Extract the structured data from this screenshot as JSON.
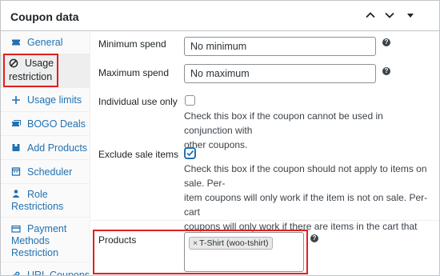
{
  "header": {
    "title": "Coupon data",
    "collapse_up_icon": "chevron-up-icon",
    "collapse_down_icon": "chevron-down-icon",
    "toggle_icon": "triangle-down-icon"
  },
  "sidebar": {
    "items": [
      {
        "label": "General",
        "icon": "ticket-icon"
      },
      {
        "label": "Usage restriction",
        "label_line1": "Usage",
        "label_line2": "restriction",
        "icon": "circle-slash-icon"
      },
      {
        "label": "Usage limits",
        "icon": "plus-sign-icon"
      },
      {
        "label": "BOGO Deals",
        "icon": "tickets-icon"
      },
      {
        "label": "Add Products",
        "icon": "package-icon"
      },
      {
        "label": "Scheduler",
        "icon": "calendar-icon"
      },
      {
        "label": "Role Restrictions",
        "label_line1": "Role",
        "label_line2": "Restrictions",
        "icon": "user-icon"
      },
      {
        "label": "Payment Methods Restriction",
        "label_line1": "Payment",
        "label_line2": "Methods",
        "label_line3": "Restriction",
        "icon": "card-icon"
      },
      {
        "label": "URL Coupons",
        "icon": "link-icon"
      }
    ]
  },
  "form": {
    "minimum_spend": {
      "label": "Minimum spend",
      "placeholder": "No minimum"
    },
    "maximum_spend": {
      "label": "Maximum spend",
      "placeholder": "No maximum"
    },
    "individual_use": {
      "label": "Individual use only",
      "checked": false,
      "desc_line1": "Check this box if the coupon cannot be used in conjunction with",
      "desc_line2": "other coupons."
    },
    "exclude_sale": {
      "label": "Exclude sale items",
      "checked": true,
      "desc_line1": "Check this box if the coupon should not apply to items on sale. Per-",
      "desc_line2": "item coupons will only work if the item is not on sale. Per-cart",
      "desc_line3": "coupons will only work if there are items in the cart that are not on",
      "desc_line4": "sale."
    },
    "products": {
      "label": "Products",
      "tags": [
        {
          "remove": "×",
          "text": "T-Shirt (woo-tshirt)"
        }
      ]
    }
  },
  "help_icon": "?",
  "colors": {
    "link": "#2271b1",
    "highlight": "#e02020",
    "check": "#2271b1"
  }
}
